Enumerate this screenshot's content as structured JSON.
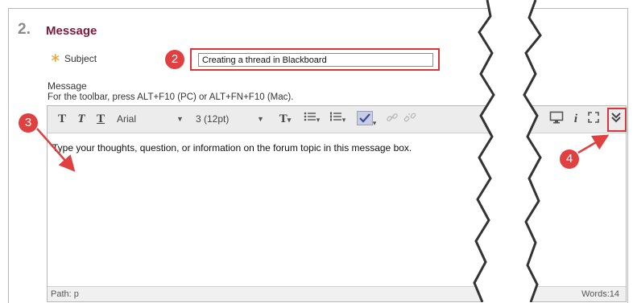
{
  "section": {
    "number": "2.",
    "title": "Message"
  },
  "subject": {
    "required_mark": "∗",
    "label": "Subject",
    "value": "Creating a thread in Blackboard"
  },
  "message": {
    "label": "Message",
    "hint": "For the toolbar, press ALT+F10 (PC) or ALT+FN+F10 (Mac)."
  },
  "toolbar": {
    "bold": "T",
    "italic": "T",
    "underline": "T",
    "font_family": "Arial",
    "font_size": "3 (12pt)",
    "dropdown_caret": "▼",
    "small_caret": "▾",
    "text_color": "T",
    "info": "i"
  },
  "editor": {
    "body_text": "Type your thoughts, question, or information on the forum topic in this message box.",
    "path": "Path: p",
    "words": "Words:14"
  },
  "callouts": {
    "c2": "2",
    "c3": "3",
    "c4": "4"
  },
  "colors": {
    "accent": "#d9363b",
    "title": "#7b1a3a",
    "required": "#e8a33a"
  }
}
